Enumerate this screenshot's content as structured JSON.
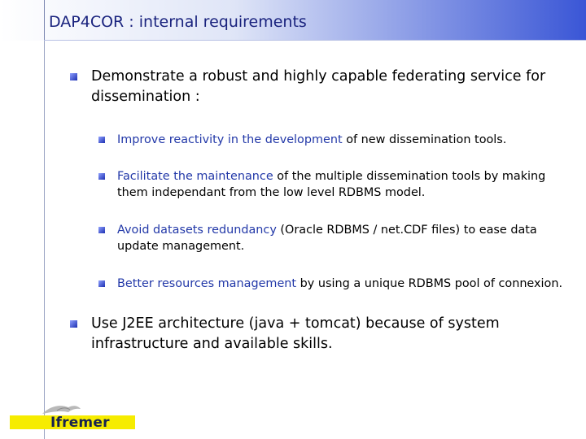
{
  "slide": {
    "title": "DAP4COR : internal requirements"
  },
  "bullets": {
    "b1": "Demonstrate a robust and highly capable federating service for dissemination  :",
    "sub1": {
      "hl": "Improve reactivity in the development",
      "rest": " of new dissemination tools."
    },
    "sub2": {
      "hl": "Facilitate the maintenance",
      "rest": " of the multiple dissemination tools by making them independant from the low level RDBMS model."
    },
    "sub3": {
      "hl": "Avoid datasets redundancy",
      "rest": " (Oracle RDBMS / net.CDF files) to ease data update management."
    },
    "sub4": {
      "hl": "Better resources management",
      "rest": " by using a unique RDBMS pool of connexion."
    },
    "b2": "Use J2EE architecture (java + tomcat) because of system infrastructure and available skills."
  },
  "logo": {
    "text": "Ifremer"
  },
  "colors": {
    "accent": "#2238a8",
    "logo_band": "#f6ec00"
  }
}
